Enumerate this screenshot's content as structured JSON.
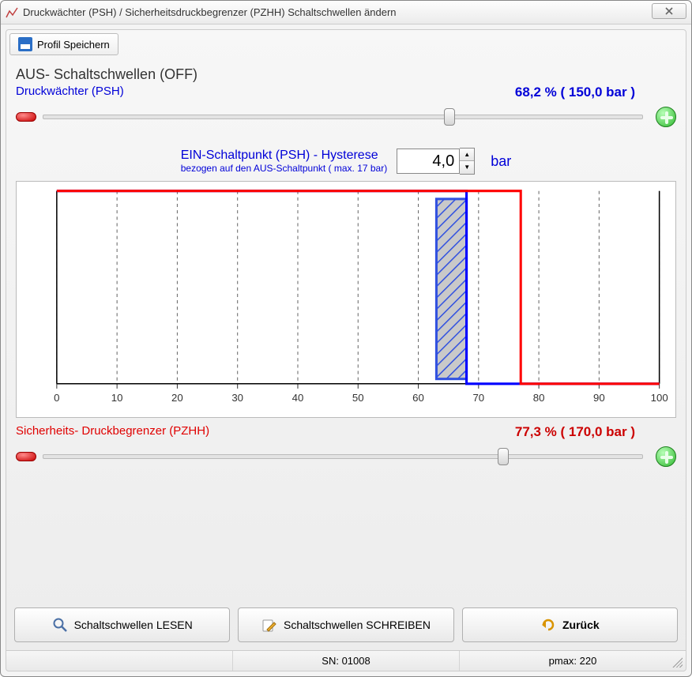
{
  "window": {
    "title": "Druckwächter (PSH) / Sicherheitsdruckbegrenzer (PZHH) Schaltschwellen ändern"
  },
  "profile": {
    "save_label": "Profil Speichern"
  },
  "section": {
    "off_title": "AUS- Schaltschwellen (OFF)"
  },
  "psh": {
    "label": "Druckwächter (PSH)",
    "value_text": "68,2 % ( 150,0 bar )",
    "slider_value": "68.2"
  },
  "hysterese": {
    "title": "EIN-Schaltpunkt (PSH) - Hysterese",
    "sub": "bezogen auf den AUS-Schaltpunkt ( max. 17 bar)",
    "value": "4,0",
    "unit": "bar"
  },
  "pzhh": {
    "label": "Sicherheits- Druckbegrenzer (PZHH)",
    "value_text": "77,3 % ( 170,0 bar )",
    "slider_value": "77.3"
  },
  "buttons": {
    "read": "Schaltschwellen LESEN",
    "write": "Schaltschwellen SCHREIBEN",
    "back": "Zurück"
  },
  "status": {
    "sn": "SN: 01008",
    "pmax": "pmax: 220"
  },
  "chart_data": {
    "type": "line",
    "xlabel": "",
    "ylabel": "",
    "xlim": [
      0,
      100
    ],
    "x_ticks": [
      0,
      10,
      20,
      30,
      40,
      50,
      60,
      70,
      80,
      90,
      100
    ],
    "series": [
      {
        "name": "PSH (blue)",
        "color": "#0000ff",
        "points": [
          [
            0,
            100
          ],
          [
            68,
            100
          ],
          [
            68,
            0
          ],
          [
            100,
            0
          ]
        ]
      },
      {
        "name": "PZHH (red)",
        "color": "#ff0000",
        "points": [
          [
            0,
            100
          ],
          [
            77,
            100
          ],
          [
            77,
            0
          ],
          [
            100,
            0
          ]
        ]
      }
    ],
    "hysteresis_band": {
      "x1": 63,
      "x2": 68,
      "color": "#3151e0"
    }
  }
}
